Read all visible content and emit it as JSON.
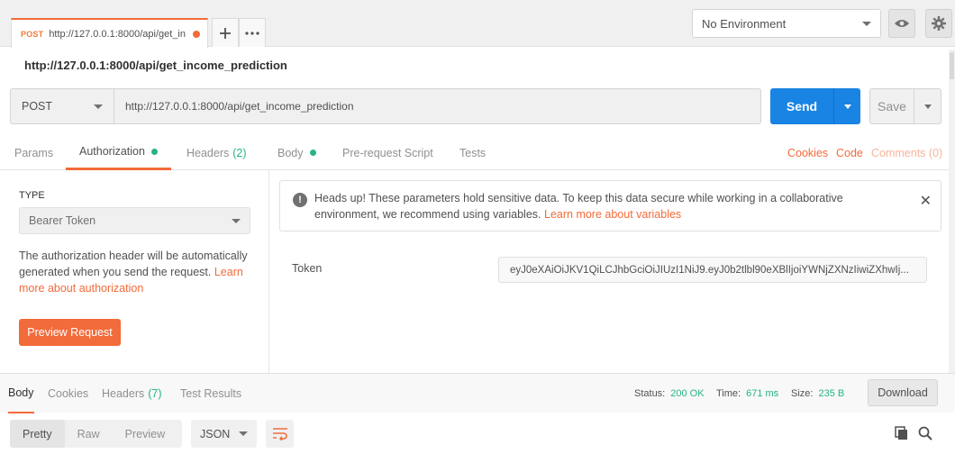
{
  "tabs": {
    "active": {
      "method": "POST",
      "url": "http://127.0.0.1:8000/api/get_in"
    },
    "new_tab_icon": "plus-icon",
    "more_icon": "more-horizontal-icon"
  },
  "environment": {
    "selected": "No Environment",
    "eye_icon": "eye-icon",
    "settings_icon": "gear-icon"
  },
  "request": {
    "title": "http://127.0.0.1:8000/api/get_income_prediction",
    "method": "POST",
    "url": "http://127.0.0.1:8000/api/get_income_prediction",
    "send_label": "Send",
    "save_label": "Save"
  },
  "request_tabs": {
    "params": "Params",
    "authorization": "Authorization",
    "headers": "Headers",
    "headers_count": "(2)",
    "body": "Body",
    "prerequest": "Pre-request Script",
    "tests": "Tests",
    "cookies": "Cookies",
    "code": "Code",
    "comments": "Comments (0)"
  },
  "auth": {
    "type_label": "TYPE",
    "type_value": "Bearer Token",
    "description": "The authorization header will be automatically generated when you send the request.",
    "learn_more": "Learn more about authorization",
    "preview_button": "Preview Request",
    "alert_text": "Heads up! These parameters hold sensitive data. To keep this data secure while working in a collaborative environment, we recommend using variables.",
    "alert_link": "Learn more about variables",
    "token_label": "Token",
    "token_value": "eyJ0eXAiOiJKV1QiLCJhbGciOiJIUzI1NiJ9.eyJ0b2tlbl90eXBlIjoiYWNjZXNzIiwiZXhwIj..."
  },
  "response": {
    "tabs": {
      "body": "Body",
      "cookies": "Cookies",
      "headers": "Headers",
      "headers_count": "(7)",
      "test_results": "Test Results"
    },
    "status_label": "Status:",
    "status_value": "200 OK",
    "time_label": "Time:",
    "time_value": "671 ms",
    "size_label": "Size:",
    "size_value": "235 B",
    "download_label": "Download",
    "formats": {
      "pretty": "Pretty",
      "raw": "Raw",
      "preview": "Preview"
    },
    "language": "JSON",
    "wrap_icon": "wrap-lines-icon",
    "copy_icon": "copy-icon",
    "search_icon": "search-icon"
  },
  "colors": {
    "accent": "#f26b3a",
    "send": "#1a84e4",
    "success": "#26b47f"
  }
}
